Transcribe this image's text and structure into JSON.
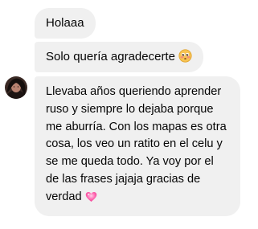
{
  "messages": [
    {
      "text": "Holaaa"
    },
    {
      "text": "Solo quería agradecerte",
      "emoji": "flushed-pleading-face-icon"
    },
    {
      "text": "Llevaba años queriendo aprender ruso y siempre lo dejaba porque me aburría. Con los mapas es otra cosa, los veo un ratito en el celu y se me queda todo. Ya voy por el de las frases jajaja gracias de verdad",
      "emoji": "pink-heart-icon"
    }
  ],
  "colors": {
    "bubble_bg": "#f0f0f0",
    "text": "#050505",
    "heart": "#ff4fa3"
  }
}
